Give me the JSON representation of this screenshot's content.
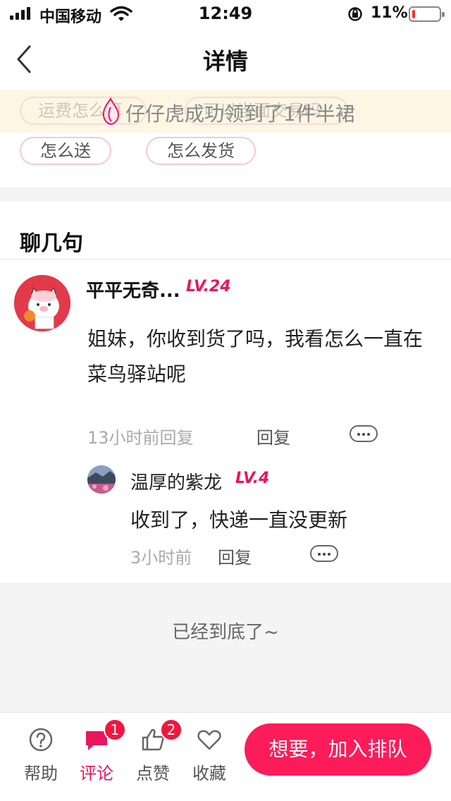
{
  "status_bar": {
    "carrier": "中国移动",
    "time": "12:49",
    "battery_percent": "11%",
    "battery_level": 0.11,
    "battery_color": "#ff2d2d",
    "icons": [
      "signal-icon",
      "wifi-icon",
      "rotation-lock-icon",
      "battery-icon"
    ]
  },
  "nav": {
    "title": "详情",
    "back_icon": "chevron-left-icon"
  },
  "tags": {
    "items": [
      "怎么送",
      "怎么发货"
    ],
    "ghost_items": [
      "运费怎么算",
      "可以当面交易吗"
    ]
  },
  "toast": {
    "text": "仔仔虎成功领到了1件半裙",
    "icon": "flame-icon"
  },
  "comments": {
    "section_title": "聊几句",
    "thread": {
      "username": "平平无奇...",
      "level": "LV.24",
      "text": "姐妹，你收到货了吗，我看怎么一直在菜鸟驿站呢",
      "time": "13小时前回复",
      "reply_label": "回复",
      "reply": {
        "username": "温厚的紫龙",
        "level": "LV.4",
        "text": "收到了，快递一直没更新",
        "time": "3小时前",
        "reply_label": "回复"
      }
    },
    "end_text": "已经到底了~"
  },
  "tabbar": {
    "help_label": "帮助",
    "comment_label": "评论",
    "comment_badge": "1",
    "like_label": "点赞",
    "like_badge": "2",
    "favorite_label": "收藏",
    "cta_label": "想要，加入排队"
  },
  "colors": {
    "accent": "#e8175d",
    "cta": "#fd1b59",
    "badge": "#f0173f"
  }
}
